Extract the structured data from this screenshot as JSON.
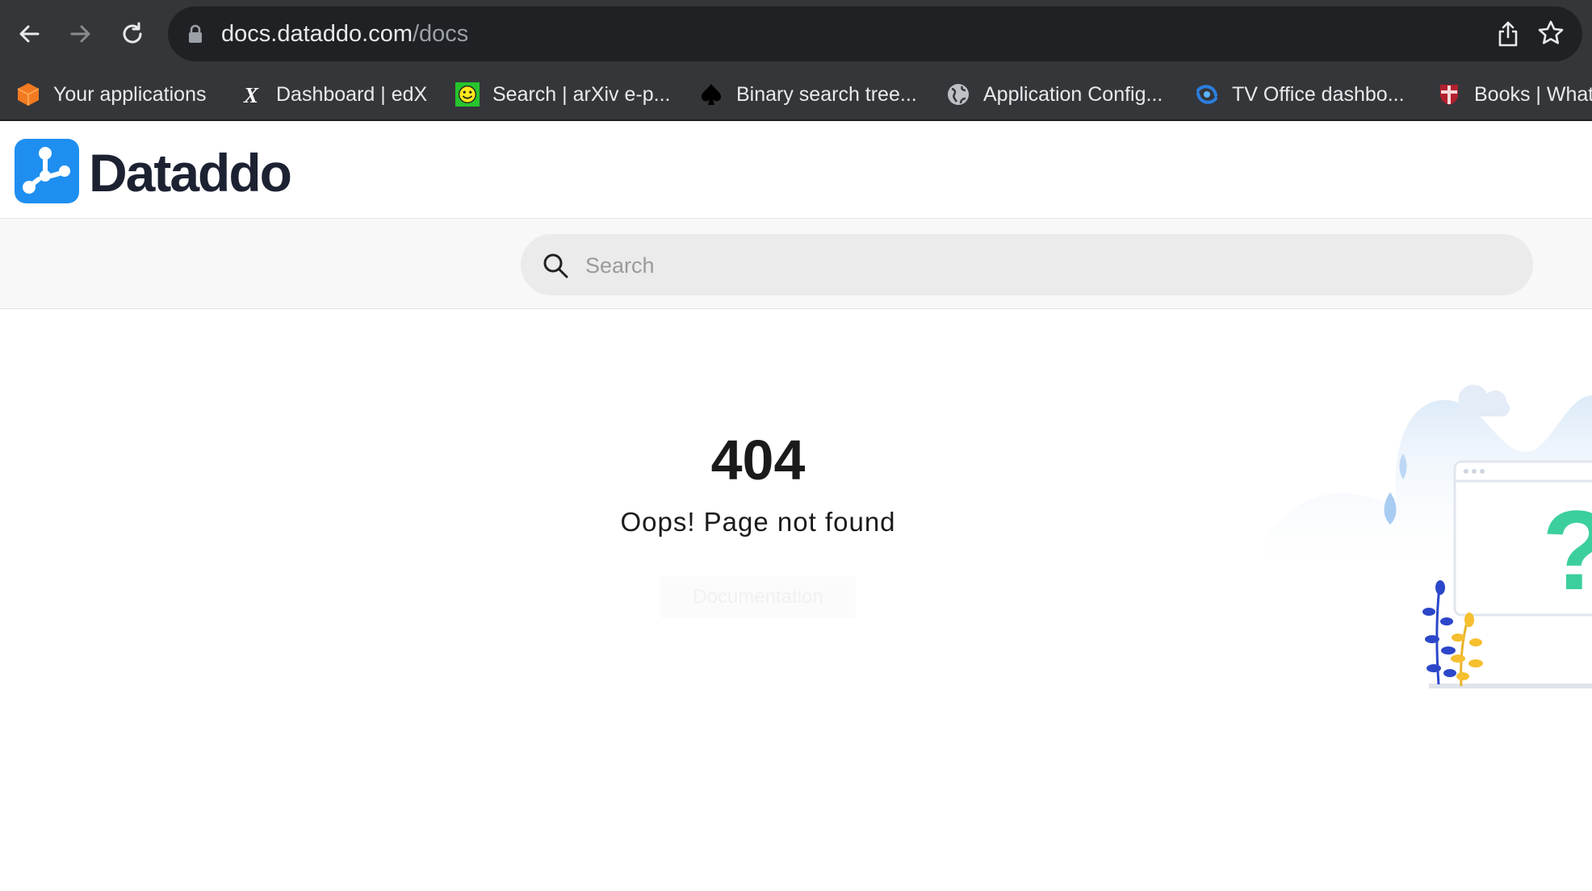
{
  "browser": {
    "url_host": "docs.dataddo.com",
    "url_path": "/docs",
    "bookmarks": [
      {
        "label": "Your applications",
        "icon": "cube-icon"
      },
      {
        "label": "Dashboard | edX",
        "icon": "edx-icon"
      },
      {
        "label": "Search | arXiv e-p...",
        "icon": "smiley-icon"
      },
      {
        "label": "Binary search tree...",
        "icon": "spade-icon"
      },
      {
        "label": "Application Config...",
        "icon": "globe-icon"
      },
      {
        "label": "TV Office dashbo...",
        "icon": "swirl-icon"
      },
      {
        "label": "Books | What",
        "icon": "shield-icon"
      }
    ]
  },
  "header": {
    "logo_text": "Dataddo"
  },
  "search": {
    "placeholder": "Search"
  },
  "error": {
    "code": "404",
    "message": "Oops! Page not found",
    "button_label": "Documentation"
  },
  "colors": {
    "brand_blue": "#1e8ff0",
    "logo_text": "#1d2233",
    "chrome_dark": "#35363a",
    "question_mark": "#3ccf9e"
  }
}
